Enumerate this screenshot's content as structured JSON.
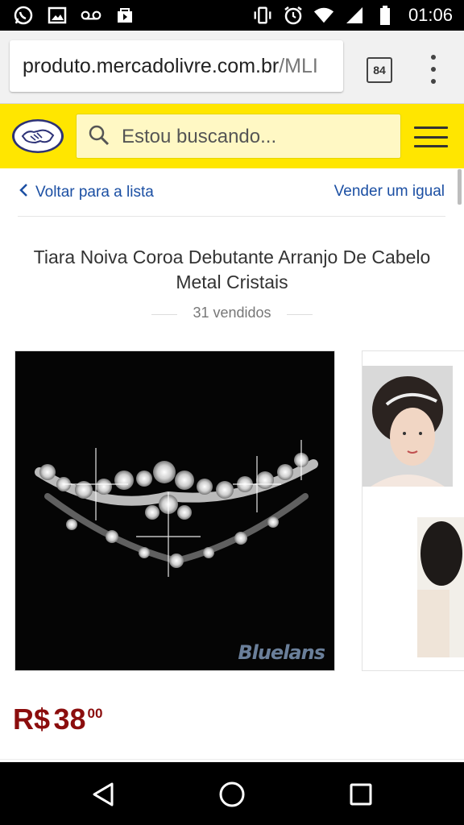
{
  "statusbar": {
    "time": "01:06",
    "left_icons": [
      "whatsapp-icon",
      "image-icon",
      "voicemail-icon",
      "store-icon"
    ],
    "right_icons": [
      "vibrate-icon",
      "alarm-icon",
      "wifi-icon",
      "signal-icon",
      "battery-icon"
    ]
  },
  "browser": {
    "url_host": "produto.mercadolivre.com.br",
    "url_path": "/MLI",
    "tab_count": "84"
  },
  "header": {
    "search_placeholder": "Estou buscando...",
    "brand_color": "#ffe600"
  },
  "nav": {
    "back_label": "Voltar para a lista",
    "sell_label": "Vender um igual",
    "link_color": "#1b4fa3"
  },
  "product": {
    "title": "Tiara Noiva Coroa Debutante Arranjo De Cabelo Metal Cristais",
    "sold": "31 vendidos",
    "image_watermark": "Bluelans",
    "price_currency": "R$",
    "price_whole": "38",
    "price_cents": "00",
    "price_color": "#8b0d0d"
  },
  "navigation_bar": {
    "buttons": [
      "back-icon",
      "home-icon",
      "recents-icon"
    ]
  }
}
